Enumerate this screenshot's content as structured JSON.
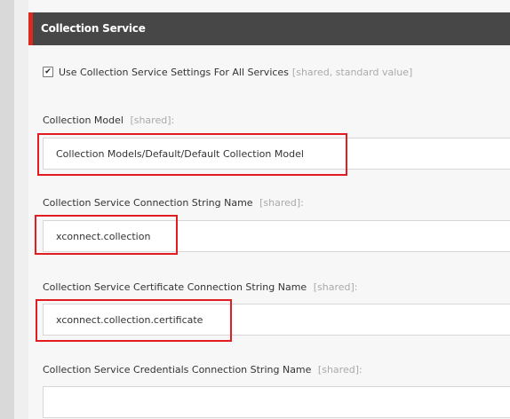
{
  "section": {
    "title": "Collection Service",
    "accent_color": "#dc291e",
    "header_color": "#474747"
  },
  "use_settings": {
    "checked": true,
    "label": "Use Collection Service Settings For All Services",
    "suffix": "[shared, standard value]"
  },
  "fields": [
    {
      "label": "Collection Model",
      "suffix": "[shared]:",
      "value": "Collection Models/Default/Default Collection Model",
      "highlighted": true
    },
    {
      "label": "Collection Service Connection String Name",
      "suffix": "[shared]:",
      "value": "xconnect.collection",
      "highlighted": true
    },
    {
      "label": "Collection Service Certificate Connection String Name",
      "suffix": "[shared]:",
      "value": "xconnect.collection.certificate",
      "highlighted": true
    },
    {
      "label": "Collection Service Credentials Connection String Name",
      "suffix": "[shared]:",
      "value": "",
      "highlighted": false
    }
  ],
  "highlight_color": "#e21c21"
}
